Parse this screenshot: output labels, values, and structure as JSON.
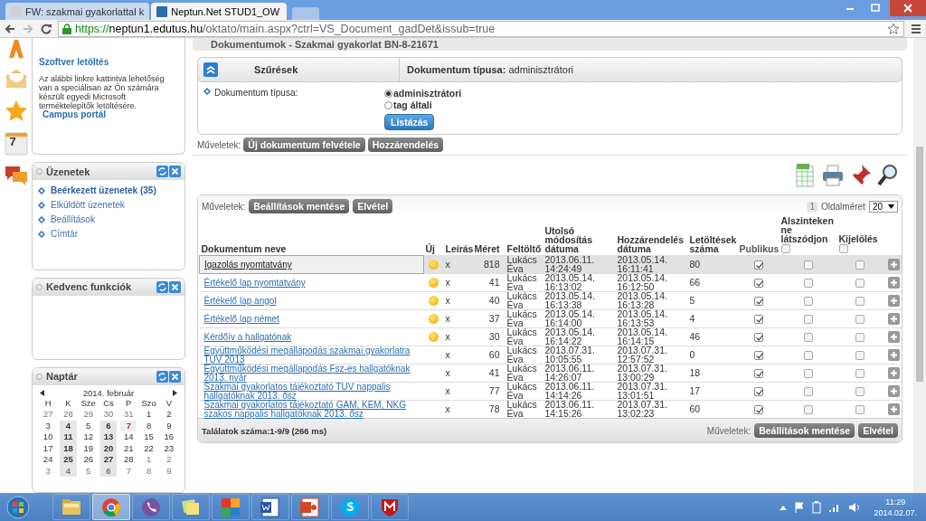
{
  "browser": {
    "tabs": [
      {
        "title": "FW: szakmai gyakorlattal k",
        "selected": false
      },
      {
        "title": "Neptun.Net STUD1_OW",
        "selected": true
      }
    ],
    "url": {
      "scheme": "https://",
      "host": "neptun1.edutus.hu",
      "path": "/oktato/main.aspx?ctrl=VS_Document_gadDet&issub=true"
    }
  },
  "icon_strip": {
    "calendar_day": "7"
  },
  "sidebar": {
    "software": {
      "title": "Szoftver letöltés",
      "text": "Az alábbi linkre kattintva lehetőség van a speciálisan az Ön számára készült egyedi Microsoft terméktelepítők letöltésére.",
      "link": "Campus portál"
    },
    "messages": {
      "title": "Üzenetek",
      "items": [
        {
          "label": "Beérkezett üzenetek (35)",
          "unread": true
        },
        {
          "label": "Elküldött üzenetek",
          "unread": false
        },
        {
          "label": "Beállítások",
          "unread": false
        },
        {
          "label": "Címtár",
          "unread": false
        }
      ]
    },
    "favorites": {
      "title": "Kedvenc funkciók"
    },
    "calendar": {
      "title": "Naptár",
      "month": "2014. február",
      "weekdays": [
        "H",
        "K",
        "Sze",
        "Cs",
        "P",
        "Szo",
        "V"
      ],
      "weeks": [
        [
          {
            "d": "27",
            "muted": true,
            "event": false,
            "today": false
          },
          {
            "d": "28",
            "muted": true,
            "event": false,
            "today": false
          },
          {
            "d": "29",
            "muted": true,
            "event": false,
            "today": false
          },
          {
            "d": "30",
            "muted": true,
            "event": false,
            "today": false
          },
          {
            "d": "31",
            "muted": true,
            "event": false,
            "today": false
          },
          {
            "d": "1",
            "muted": false,
            "event": false,
            "today": false
          },
          {
            "d": "2",
            "muted": false,
            "event": false,
            "today": false
          }
        ],
        [
          {
            "d": "3",
            "muted": false,
            "event": false,
            "today": false
          },
          {
            "d": "4",
            "muted": false,
            "event": true,
            "today": false
          },
          {
            "d": "5",
            "muted": false,
            "event": false,
            "today": false
          },
          {
            "d": "6",
            "muted": false,
            "event": true,
            "today": false
          },
          {
            "d": "7",
            "muted": false,
            "event": false,
            "today": true
          },
          {
            "d": "8",
            "muted": false,
            "event": false,
            "today": false
          },
          {
            "d": "9",
            "muted": false,
            "event": false,
            "today": false
          }
        ],
        [
          {
            "d": "10",
            "muted": false,
            "event": false,
            "today": false
          },
          {
            "d": "11",
            "muted": false,
            "event": true,
            "today": false
          },
          {
            "d": "12",
            "muted": false,
            "event": false,
            "today": false
          },
          {
            "d": "13",
            "muted": false,
            "event": true,
            "today": false
          },
          {
            "d": "14",
            "muted": false,
            "event": false,
            "today": false
          },
          {
            "d": "15",
            "muted": false,
            "event": false,
            "today": false
          },
          {
            "d": "16",
            "muted": false,
            "event": false,
            "today": false
          }
        ],
        [
          {
            "d": "17",
            "muted": false,
            "event": false,
            "today": false
          },
          {
            "d": "18",
            "muted": false,
            "event": true,
            "today": false
          },
          {
            "d": "19",
            "muted": false,
            "event": false,
            "today": false
          },
          {
            "d": "20",
            "muted": false,
            "event": true,
            "today": false
          },
          {
            "d": "21",
            "muted": false,
            "event": false,
            "today": false
          },
          {
            "d": "22",
            "muted": false,
            "event": false,
            "today": false
          },
          {
            "d": "23",
            "muted": false,
            "event": false,
            "today": false
          }
        ],
        [
          {
            "d": "24",
            "muted": false,
            "event": false,
            "today": false
          },
          {
            "d": "25",
            "muted": false,
            "event": true,
            "today": false
          },
          {
            "d": "26",
            "muted": false,
            "event": false,
            "today": false
          },
          {
            "d": "27",
            "muted": false,
            "event": true,
            "today": false
          },
          {
            "d": "28",
            "muted": false,
            "event": false,
            "today": false
          },
          {
            "d": "1",
            "muted": true,
            "event": false,
            "today": false
          },
          {
            "d": "2",
            "muted": true,
            "event": false,
            "today": false
          }
        ],
        [
          {
            "d": "3",
            "muted": true,
            "event": false,
            "today": false
          },
          {
            "d": "4",
            "muted": true,
            "event": true,
            "today": false
          },
          {
            "d": "5",
            "muted": true,
            "event": false,
            "today": false
          },
          {
            "d": "6",
            "muted": true,
            "event": true,
            "today": false
          },
          {
            "d": "7",
            "muted": true,
            "event": false,
            "today": false
          },
          {
            "d": "8",
            "muted": true,
            "event": false,
            "today": false
          },
          {
            "d": "9",
            "muted": true,
            "event": false,
            "today": false
          }
        ]
      ]
    }
  },
  "page_title": "Dokumentumok - Szakmai gyakorlat BN-8-21671",
  "filter": {
    "title": "Szűrések",
    "summary": "**Dokumentum típusa:** adminisztrátori",
    "field_label": "Dokumentum típusa:",
    "options": [
      {
        "label": "adminisztrátori",
        "selected": true
      },
      {
        "label": "tag általi",
        "selected": false
      }
    ],
    "button": "Listázás"
  },
  "actions": {
    "label": "Műveletek:",
    "buttons": [
      "Új dokumentum felvétele",
      "Hozzárendelés"
    ]
  },
  "table": {
    "actions_label": "Műveletek:",
    "buttons": [
      "Beállítások mentése",
      "Elvétel"
    ],
    "page": "1",
    "page_size_label": "Oldalméret",
    "page_size": "20",
    "columns": [
      {
        "label": "Dokumentum neve"
      },
      {
        "label": "Új"
      },
      {
        "label": "Leírás"
      },
      {
        "label": "Méret"
      },
      {
        "label": "Feltöltő"
      },
      {
        "label": "Utolsó módosítás dátuma"
      },
      {
        "label": "Hozzárendelés dátuma"
      },
      {
        "label": "Letöltések száma"
      },
      {
        "label": "Publikus"
      },
      {
        "label": "Alszinteken ne látszódjon",
        "checked": false
      },
      {
        "label": "Kijelölés",
        "checked": false
      }
    ],
    "rows": [
      {
        "name": "Igazolás nyomtatvány",
        "selected": true,
        "new": true,
        "desc": "x",
        "size": "818",
        "uploader": "Lukács Éva",
        "modified": "2013.06.11. 14:24:49",
        "assigned": "2013.05.14. 16:11:41",
        "downloads": "80",
        "public": true,
        "hidden": false,
        "marked": false
      },
      {
        "name": "Értékelő lap nyomtatvány",
        "selected": false,
        "new": true,
        "desc": "x",
        "size": "41",
        "uploader": "Lukács Éva",
        "modified": "2013.05.14. 16:13:02",
        "assigned": "2013.05.14. 16:12:50",
        "downloads": "66",
        "public": true,
        "hidden": false,
        "marked": false
      },
      {
        "name": "Értékelő lap angol",
        "selected": false,
        "new": true,
        "desc": "x",
        "size": "40",
        "uploader": "Lukács Éva",
        "modified": "2013.05.14. 16:13:38",
        "assigned": "2013.05.14. 16:13:28",
        "downloads": "5",
        "public": true,
        "hidden": false,
        "marked": false
      },
      {
        "name": "Értékelő lap német",
        "selected": false,
        "new": true,
        "desc": "x",
        "size": "37",
        "uploader": "Lukács Éva",
        "modified": "2013.05.14. 16:14:00",
        "assigned": "2013.05.14. 16:13:53",
        "downloads": "4",
        "public": true,
        "hidden": false,
        "marked": false
      },
      {
        "name": "Kérdőív a hallgatónak",
        "selected": false,
        "new": true,
        "desc": "x",
        "size": "30",
        "uploader": "Lukács Éva",
        "modified": "2013.05.14. 16:14:22",
        "assigned": "2013.05.14. 16:14:15",
        "downloads": "46",
        "public": true,
        "hidden": false,
        "marked": false
      },
      {
        "name": "Együttműködési megállapodás szakmai gyakorlatra TUV 2013",
        "selected": false,
        "new": false,
        "desc": "x",
        "size": "60",
        "uploader": "Lukács Éva",
        "modified": "2013.07.31. 10:05:55",
        "assigned": "2013.07.31. 12:57:52",
        "downloads": "0",
        "public": true,
        "hidden": false,
        "marked": false
      },
      {
        "name": "Együttműködési megállapodás Fsz-es hallgatóknak 2013. nyár",
        "selected": false,
        "new": false,
        "desc": "x",
        "size": "41",
        "uploader": "Lukács Éva",
        "modified": "2013.06.11. 14:26:07",
        "assigned": "2013.07.31. 13:00:29",
        "downloads": "18",
        "public": true,
        "hidden": false,
        "marked": false
      },
      {
        "name": "Szakmai gyakorlatos tájékoztató TUV nappalis hallgatóknak 2013. ősz",
        "selected": false,
        "new": false,
        "desc": "x",
        "size": "77",
        "uploader": "Lukács Éva",
        "modified": "2013.06.11. 14:14:26",
        "assigned": "2013.07.31. 13:01:51",
        "downloads": "17",
        "public": true,
        "hidden": false,
        "marked": false
      },
      {
        "name": "Szakmai gyakorlatos tájékoztató GAM, KEM, NKG szakos nappalis hallgatóknak 2013. ősz",
        "selected": false,
        "new": false,
        "desc": "x",
        "size": "78",
        "uploader": "Lukács Éva",
        "modified": "2013.06.11. 14:15:26",
        "assigned": "2013.07.31. 13:02:23",
        "downloads": "60",
        "public": true,
        "hidden": false,
        "marked": false
      }
    ],
    "footer": "Találatok száma:1-9/9 (266 ms)",
    "footer_actions_label": "Műveletek:",
    "footer_buttons": [
      "Beállítások mentése",
      "Elvétel"
    ]
  },
  "taskbar": {
    "apps": [
      {
        "kind": "folder",
        "selected": false
      },
      {
        "kind": "chrome",
        "selected": true
      },
      {
        "kind": "viber",
        "selected": false
      },
      {
        "kind": "notes",
        "selected": false
      },
      {
        "kind": "avg",
        "selected": false
      },
      {
        "kind": "word",
        "selected": false
      },
      {
        "kind": "powerpoint",
        "selected": false
      },
      {
        "kind": "skype",
        "selected": false
      },
      {
        "kind": "mcafee",
        "selected": false
      }
    ],
    "time": "11:29",
    "date": "2014.02.07."
  }
}
